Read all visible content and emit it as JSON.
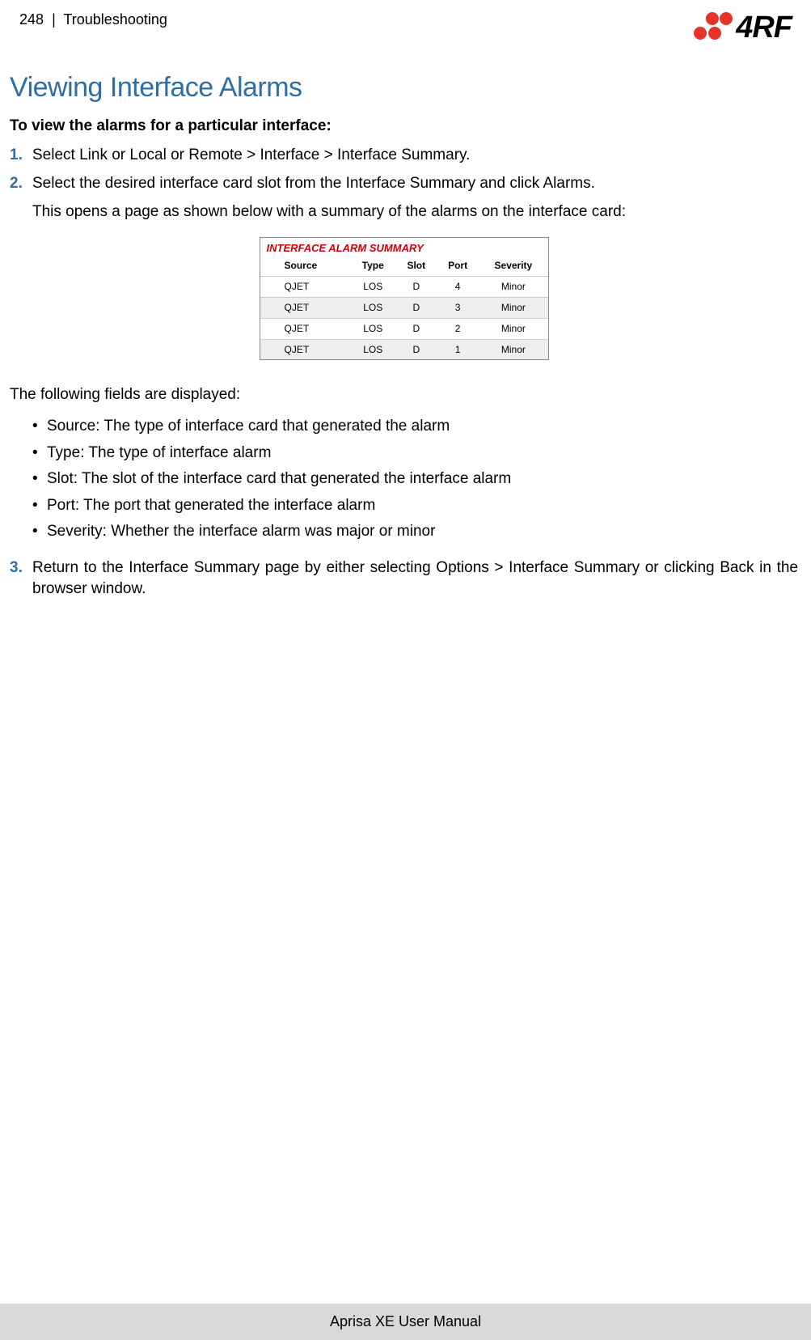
{
  "header": {
    "page_number": "248",
    "separator": "|",
    "section": "Troubleshooting",
    "brand": "4RF"
  },
  "content": {
    "title": "Viewing Interface Alarms",
    "intro": "To view the alarms for a particular interface:",
    "steps": {
      "s1": {
        "num": "1.",
        "text": "Select Link or Local or Remote > Interface > Interface Summary."
      },
      "s2": {
        "num": "2.",
        "text": "Select the desired interface card slot from the Interface Summary and click Alarms."
      },
      "s2_follow": "This opens a page as shown below with a summary of the alarms on the interface card:"
    },
    "table": {
      "title": "INTERFACE ALARM SUMMARY",
      "headers": {
        "h1": "Source",
        "h2": "Type",
        "h3": "Slot",
        "h4": "Port",
        "h5": "Severity"
      },
      "rows": [
        {
          "source": "QJET",
          "type": "LOS",
          "slot": "D",
          "port": "4",
          "severity": "Minor"
        },
        {
          "source": "QJET",
          "type": "LOS",
          "slot": "D",
          "port": "3",
          "severity": "Minor"
        },
        {
          "source": "QJET",
          "type": "LOS",
          "slot": "D",
          "port": "2",
          "severity": "Minor"
        },
        {
          "source": "QJET",
          "type": "LOS",
          "slot": "D",
          "port": "1",
          "severity": "Minor"
        }
      ]
    },
    "fields_intro": "The following fields are displayed:",
    "bullets": {
      "b1": "Source: The type of interface card that generated the alarm",
      "b2": "Type: The type of interface alarm",
      "b3": "Slot: The slot of the interface card that generated the interface alarm",
      "b4": "Port: The port that generated the interface alarm",
      "b5": "Severity: Whether the interface alarm was major or minor"
    },
    "step3": {
      "num": "3.",
      "text": "Return to the Interface Summary page by either selecting Options > Interface Summary or clicking Back in the browser window."
    }
  },
  "footer": "Aprisa XE User Manual",
  "chart_data": {
    "type": "table",
    "title": "INTERFACE ALARM SUMMARY",
    "columns": [
      "Source",
      "Type",
      "Slot",
      "Port",
      "Severity"
    ],
    "rows": [
      [
        "QJET",
        "LOS",
        "D",
        4,
        "Minor"
      ],
      [
        "QJET",
        "LOS",
        "D",
        3,
        "Minor"
      ],
      [
        "QJET",
        "LOS",
        "D",
        2,
        "Minor"
      ],
      [
        "QJET",
        "LOS",
        "D",
        1,
        "Minor"
      ]
    ]
  }
}
